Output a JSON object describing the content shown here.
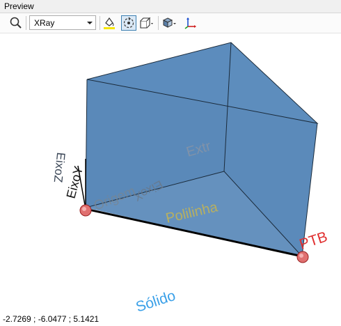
{
  "panel": {
    "title": "Preview"
  },
  "toolbar": {
    "render_mode": {
      "selected": "XRay"
    },
    "buttons": [
      {
        "icon": "magnifier-icon"
      },
      {
        "icon": "paint-bucket-icon"
      },
      {
        "icon": "rotate-view-icon",
        "active": true
      },
      {
        "icon": "view-cube-icon"
      },
      {
        "icon": "display-options-icon"
      },
      {
        "icon": "axes-icon"
      }
    ]
  },
  "scene": {
    "labels": {
      "extr": "Extr",
      "origem": "Origem",
      "eixox": "EixoX",
      "eixoy": "EixoY",
      "eixoz": "EixoZ",
      "polilinha": "Polilinha",
      "ptb": "PTB",
      "solido": "Sólido"
    },
    "colors": {
      "solid_fill": "#4a7fb5",
      "edge": "#1a2a3a",
      "point": "#e07070",
      "ptb": "#e03030",
      "solido": "#3aa0e8",
      "polilinha": "#b8b060"
    }
  },
  "status": {
    "coordinates": "-2.7269 ; -6.0477 ; 5.1421"
  }
}
